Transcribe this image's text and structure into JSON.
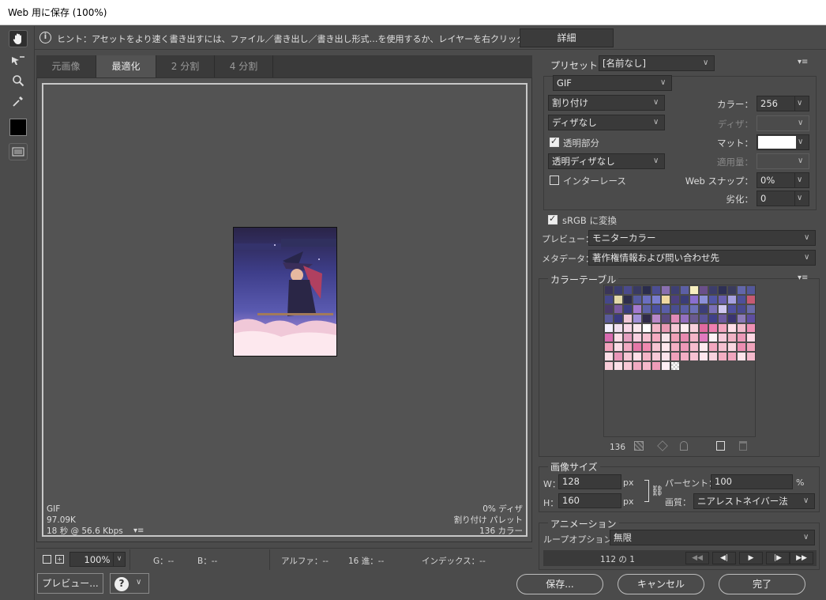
{
  "window": {
    "title": "Web 用に保存 (100%)"
  },
  "hint": {
    "text": "ヒント：アセットをより速く書き出すには、ファイル／書き出し／書き出し形式…を使用するか、レイヤーを右クリックして使用。",
    "details_label": "詳細"
  },
  "tabs": [
    "元画像",
    "最適化",
    "2 分割",
    "4 分割"
  ],
  "image_info": {
    "format": "GIF",
    "size": "97.09K",
    "time": "18 秒 @ 56.6 Kbps",
    "dither": "0% ディザ",
    "palette": "割り付け パレット",
    "colors": "136 カラー"
  },
  "status": {
    "zoom": "100%",
    "g": "G：--",
    "b": "B：--",
    "alpha": "アルファ：--",
    "hex": "16 進：--",
    "index": "インデックス：--"
  },
  "bottom": {
    "preview_label": "プレビュー...",
    "save_label": "保存...",
    "cancel_label": "キャンセル",
    "done_label": "完了"
  },
  "preset": {
    "label": "プリセット：",
    "value": "[名前なし]"
  },
  "settings": {
    "format": "GIF",
    "reduction": "割り付け",
    "dither_algo": "ディザなし",
    "transparency_label": "透明部分",
    "transparency_dither": "透明ディザなし",
    "interlace_label": "インターレース",
    "colors_label": "カラー：",
    "colors_value": "256",
    "dither_label": "ディザ：",
    "matte_label": "マット：",
    "amount_label": "適用量：",
    "websnap_label": "Web スナップ：",
    "websnap_value": "0%",
    "lossy_label": "劣化：",
    "lossy_value": "0"
  },
  "convert": {
    "srgb_label": "sRGB に変換",
    "preview_label": "プレビュー：",
    "preview_value": "モニターカラー",
    "metadata_label": "メタデータ：",
    "metadata_value": "著作権情報および問い合わせ先"
  },
  "color_table": {
    "title": "カラーテーブル",
    "count": "136",
    "colors": [
      "#3a3558",
      "#3b3d6f",
      "#4a4a8c",
      "#393a62",
      "#2a2c4d",
      "#4c4e93",
      "#8a6fb0",
      "#3e3f72",
      "#5c5fa5",
      "#f7efc0",
      "#6a4f8a",
      "#3c3d6a",
      "#2e3055",
      "#3a3b5c",
      "#6266aa",
      "#54589a",
      "#45478a",
      "#e3d9a8",
      "#2d2d4c",
      "#555aa0",
      "#6a6ec0",
      "#7a7ed0",
      "#f0d8a0",
      "#4d4180",
      "#3b3d78",
      "#8a6fd0",
      "#8c90d8",
      "#5256a6",
      "#6a60b0",
      "#a6a0e0",
      "#4e509a",
      "#c65a72",
      "#4a3a68",
      "#7a5aa0",
      "#3a3d80",
      "#a47ad0",
      "#5d62a8",
      "#4b50a0",
      "#5a5ea8",
      "#4a4e90",
      "#5a5ea6",
      "#6c70b8",
      "#3c3e78",
      "#7b70b8",
      "#d0c8f0",
      "#5050a0",
      "#4a4a90",
      "#6a6aa8",
      "#5a5a9a",
      "#3a3a80",
      "#f0c8d8",
      "#a090d8",
      "#2f2a48",
      "#b888c8",
      "#5a4a80",
      "#e08ab8",
      "#9470c0",
      "#6a5a90",
      "#5a5498",
      "#404088",
      "#6c5aa0",
      "#3a3470",
      "#8b7ab8",
      "#5e4ea0",
      "#f4f0ff",
      "#f0e0f0",
      "#f8d8e8",
      "#fbe8ee",
      "#ffffff",
      "#f2b6c8",
      "#e89ab4",
      "#f6c8d6",
      "#ffeef2",
      "#f9d0dc",
      "#e06aa0",
      "#ee7fb0",
      "#f3a6c0",
      "#ffe0e8",
      "#f2bccc",
      "#ef90b4",
      "#d86ab0",
      "#fcdce6",
      "#e4a0c0",
      "#f8d0e0",
      "#f6c0d0",
      "#f4aac0",
      "#f8e4ea",
      "#f0a0b8",
      "#e88ab0",
      "#f4b4c8",
      "#e07ac0",
      "#fff2f6",
      "#f6cada",
      "#f0b2c4",
      "#ec9ab8",
      "#ffd8e4",
      "#f2a2bc",
      "#fadbe6",
      "#f0aac2",
      "#e478a8",
      "#f08ab0",
      "#f7c4d2",
      "#ffe8ee",
      "#f4b0c4",
      "#ee98b8",
      "#f6bcce",
      "#ffeaf0",
      "#f2a8c0",
      "#f4c0d0",
      "#f9d6e0",
      "#ec8eb2",
      "#f0a4bc",
      "#fbdde6",
      "#e896b8",
      "#f6c6d4",
      "#ffdfe8",
      "#f3b4c6",
      "#f8cad8",
      "#fce4ec",
      "#efa0ba",
      "#f3aec4",
      "#f6c2d2",
      "#ffe6ee",
      "#f8d2de",
      "#f2aec2",
      "#f0a6be",
      "#fde4ea",
      "#f4bacc",
      "#f8ccd8",
      "#fce0e8",
      "#f7c8d6",
      "#f1aac2",
      "#f5b8ca",
      "#ee9cb8",
      "#ffeef4",
      "transparent"
    ]
  },
  "image_size": {
    "title": "画像サイズ",
    "w_label": "W：",
    "w_value": "128",
    "h_label": "H：",
    "h_value": "160",
    "unit": "px",
    "percent_label": "パーセント：",
    "percent_value": "100",
    "percent_unit": "%",
    "quality_label": "画質：",
    "quality_value": "ニアレストネイバー法"
  },
  "animation": {
    "title": "アニメーション",
    "loop_label": "ループオプション：",
    "loop_value": "無限",
    "frame_text": "112 の 1"
  }
}
